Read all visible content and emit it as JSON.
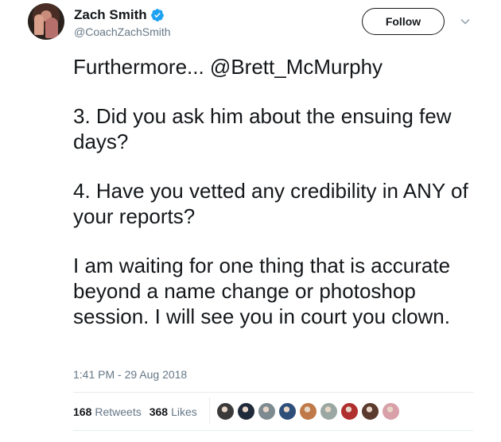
{
  "tweet": {
    "author": {
      "display_name": "Zach Smith",
      "handle": "@CoachZachSmith",
      "verified": true,
      "verified_icon": "verified-badge-icon",
      "avatar_icon": "profile-avatar"
    },
    "follow_label": "Follow",
    "menu_icon": "chevron-down-icon",
    "paragraphs": [
      "Furthermore... @Brett_McMurphy",
      "3.  Did you ask him about the ensuing few days?",
      "4.  Have you vetted any credibility in ANY of your reports?",
      "I am waiting for one thing that is accurate beyond a name change or photoshop session.  I will see you in court you clown."
    ],
    "timestamp": "1:41 PM - 29 Aug 2018",
    "stats": {
      "retweets_count": "168",
      "retweets_label": "Retweets",
      "likes_count": "368",
      "likes_label": "Likes"
    },
    "liker_avatars": [
      {
        "icon": "liker-avatar-1",
        "color": "#3a3a3a"
      },
      {
        "icon": "liker-avatar-2",
        "color": "#1f2a3a"
      },
      {
        "icon": "liker-avatar-3",
        "color": "#7d8a8f"
      },
      {
        "icon": "liker-avatar-4",
        "color": "#2e4f7a"
      },
      {
        "icon": "liker-avatar-5",
        "color": "#c07a4a"
      },
      {
        "icon": "liker-avatar-6",
        "color": "#9aa7a2"
      },
      {
        "icon": "liker-avatar-7",
        "color": "#b03030"
      },
      {
        "icon": "liker-avatar-8",
        "color": "#5a3b2e"
      },
      {
        "icon": "liker-avatar-9",
        "color": "#d8a0a8"
      }
    ],
    "colors": {
      "text": "#14171a",
      "secondary": "#657786",
      "verified": "#1da1f2",
      "divider": "#e6ecf0"
    }
  }
}
